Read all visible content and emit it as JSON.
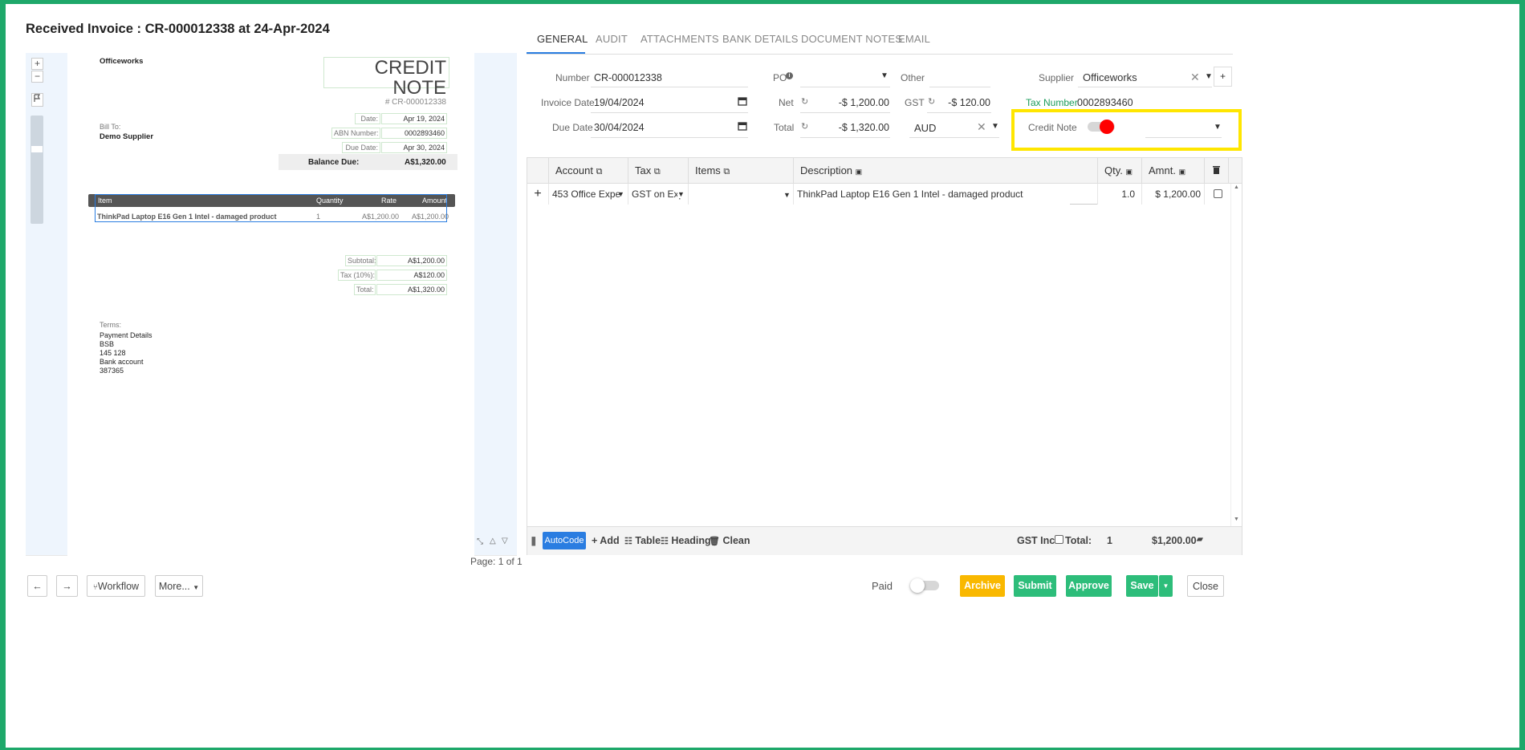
{
  "window": {
    "title": "Received Invoice : CR-000012338 at 24-Apr-2024"
  },
  "viewer": {
    "zoom_in": "+",
    "zoom_out": "−",
    "page_label": "Page: 1 of 1",
    "document": {
      "company": "Officeworks",
      "doc_type": "CREDIT NOTE",
      "doc_number": "# CR-000012338",
      "meta": [
        {
          "label": "Date:",
          "value": "Apr 19, 2024"
        },
        {
          "label": "ABN Number:",
          "value": "0002893460"
        },
        {
          "label": "Due Date:",
          "value": "Apr 30, 2024"
        }
      ],
      "bill_to_label": "Bill To:",
      "bill_to_name": "Demo Supplier",
      "balance_label": "Balance Due:",
      "balance_value": "A$1,320.00",
      "table_headers": [
        "Item",
        "Quantity",
        "Rate",
        "Amount"
      ],
      "line": {
        "item": "ThinkPad Laptop E16 Gen 1 Intel - damaged product",
        "qty": "1",
        "rate": "A$1,200.00",
        "amount": "A$1,200.00"
      },
      "totals": [
        {
          "label": "Subtotal:",
          "value": "A$1,200.00"
        },
        {
          "label": "Tax (10%):",
          "value": "A$120.00"
        },
        {
          "label": "Total:",
          "value": "A$1,320.00"
        }
      ],
      "terms_label": "Terms:",
      "terms_lines": [
        "Payment Details",
        "BSB",
        "145 128",
        "Bank account",
        "387365"
      ]
    }
  },
  "tabs": [
    "GENERAL",
    "AUDIT",
    "ATTACHMENTS",
    "BANK DETAILS",
    "DOCUMENT NOTES",
    "EMAIL"
  ],
  "form": {
    "number_label": "Number",
    "number": "CR-000012338",
    "invoice_date_label": "Invoice Date",
    "invoice_date": "19/04/2024",
    "due_date_label": "Due Date",
    "due_date": "30/04/2024",
    "po_label": "PO",
    "other_label": "Other",
    "net_label": "Net",
    "net": "-$ 1,200.00",
    "gst_label": "GST",
    "gst": "-$ 120.00",
    "total_label": "Total",
    "total": "-$ 1,320.00",
    "currency": "AUD",
    "supplier_label": "Supplier",
    "supplier": "Officeworks",
    "tax_number_label": "Tax Number",
    "tax_number": "0002893460",
    "credit_note_label": "Credit Note"
  },
  "grid": {
    "headers": [
      "Account",
      "Tax",
      "Items",
      "Description",
      "Qty.",
      "Amnt."
    ],
    "row": {
      "account": "453 Office Expe",
      "tax": "GST on Exp",
      "items": "",
      "description": "ThinkPad Laptop E16 Gen 1 Intel - damaged product",
      "qty": "1.0",
      "amount": "$ 1,200.00"
    },
    "footer": {
      "autocode": "AutoCode",
      "add": "+ Add",
      "table": "Table",
      "heading": "Heading",
      "clean": "Clean",
      "gst_inc": "GST Inc:",
      "total_label": "Total:",
      "count": "1",
      "total": "$1,200.00"
    }
  },
  "actions": {
    "workflow": "Workflow",
    "more": "More...",
    "paid": "Paid",
    "archive": "Archive",
    "submit": "Submit",
    "approve": "Approve",
    "save": "Save",
    "close": "Close"
  },
  "colors": {
    "accent": "#2a7de1",
    "green": "#2dbd7a",
    "yellow": "#f9b800",
    "highlight": "#ffe600",
    "toggle_red": "#ff0000"
  }
}
